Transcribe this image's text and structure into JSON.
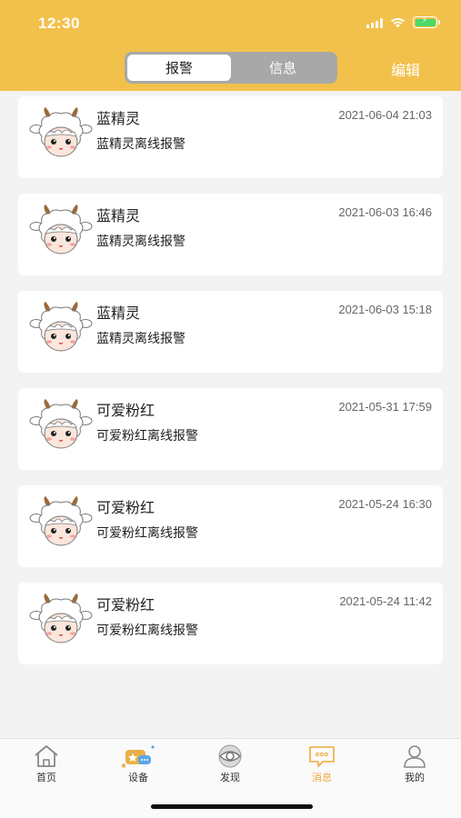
{
  "status_bar": {
    "time": "12:30"
  },
  "header": {
    "tabs": [
      {
        "label": "报警"
      },
      {
        "label": "信息"
      }
    ],
    "edit_label": "编辑"
  },
  "alerts": [
    {
      "name": "蓝精灵",
      "time": "2021-06-04 21:03",
      "message": "蓝精灵离线报警"
    },
    {
      "name": "蓝精灵",
      "time": "2021-06-03 16:46",
      "message": "蓝精灵离线报警"
    },
    {
      "name": "蓝精灵",
      "time": "2021-06-03 15:18",
      "message": "蓝精灵离线报警"
    },
    {
      "name": "可爱粉红",
      "time": "2021-05-31 17:59",
      "message": "可爱粉红离线报警"
    },
    {
      "name": "可爱粉红",
      "time": "2021-05-24 16:30",
      "message": "可爱粉红离线报警"
    },
    {
      "name": "可爱粉红",
      "time": "2021-05-24 11:42",
      "message": "可爱粉红离线报警"
    }
  ],
  "tabbar": {
    "items": [
      {
        "label": "首页",
        "icon": "home-icon"
      },
      {
        "label": "设备",
        "icon": "device-icon"
      },
      {
        "label": "发现",
        "icon": "eye-icon"
      },
      {
        "label": "消息",
        "icon": "message-icon"
      },
      {
        "label": "我的",
        "icon": "person-icon"
      }
    ],
    "active_index": 3
  },
  "colors": {
    "header": "#f2c14b",
    "accent": "#f0a93b",
    "background": "#f3f3f3"
  }
}
